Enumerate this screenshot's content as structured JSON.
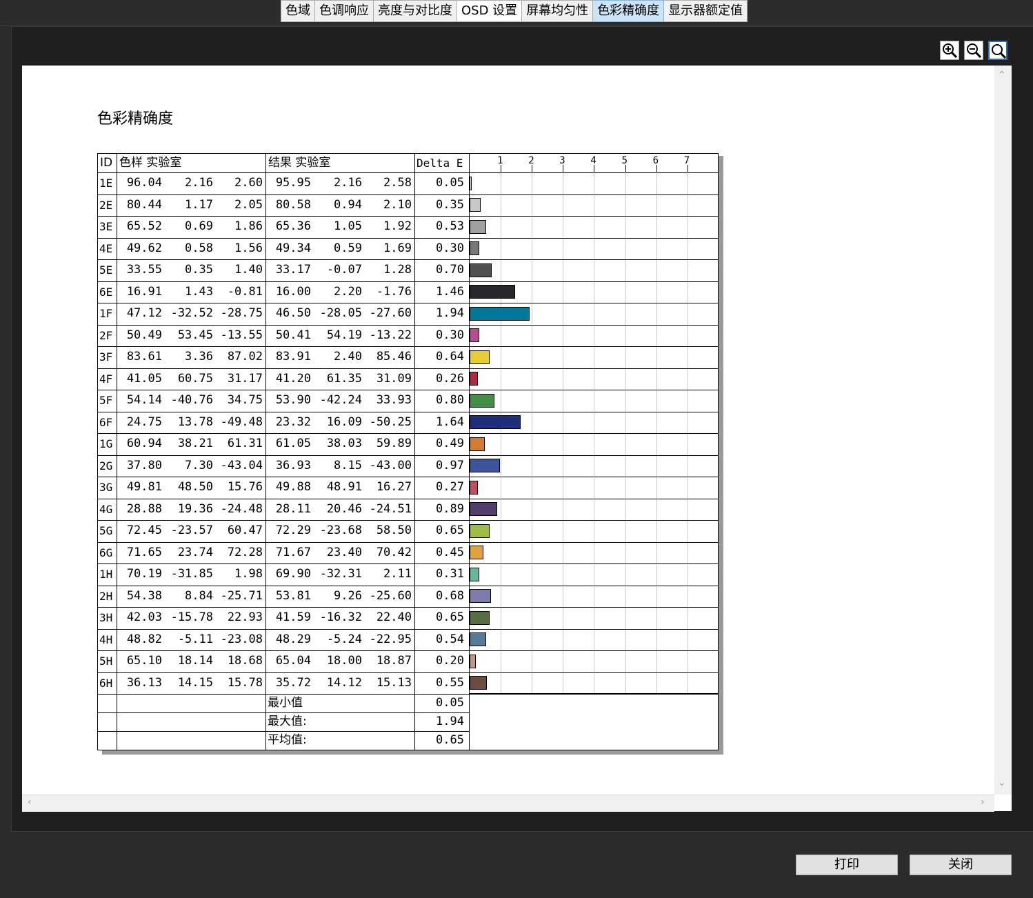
{
  "tabs": [
    "色域",
    "色调响应",
    "亮度与对比度",
    "OSD 设置",
    "屏幕均匀性",
    "色彩精确度",
    "显示器额定值"
  ],
  "active_tab": "色彩精确度",
  "zoom_icons": [
    "zoom-in-icon",
    "zoom-out-icon",
    "zoom-reset-icon"
  ],
  "report": {
    "title": "色彩精确度"
  },
  "table": {
    "headers": {
      "id": "ID",
      "sample": "色样 实验室",
      "result": "结果 实验室",
      "delta": "Delta E"
    },
    "axis_ticks": [
      "1",
      "2",
      "3",
      "4",
      "5",
      "6",
      "7"
    ],
    "rows": [
      {
        "id": "1E",
        "s": [
          "96.04",
          "2.16",
          "2.60"
        ],
        "r": [
          "95.95",
          "2.16",
          "2.58"
        ],
        "de": "0.05",
        "color": "#f2f2f2"
      },
      {
        "id": "2E",
        "s": [
          "80.44",
          "1.17",
          "2.05"
        ],
        "r": [
          "80.58",
          "0.94",
          "2.10"
        ],
        "de": "0.35",
        "color": "#c8c8c8"
      },
      {
        "id": "3E",
        "s": [
          "65.52",
          "0.69",
          "1.86"
        ],
        "r": [
          "65.36",
          "1.05",
          "1.92"
        ],
        "de": "0.53",
        "color": "#a0a0a0"
      },
      {
        "id": "4E",
        "s": [
          "49.62",
          "0.58",
          "1.56"
        ],
        "r": [
          "49.34",
          "0.59",
          "1.69"
        ],
        "de": "0.30",
        "color": "#787878"
      },
      {
        "id": "5E",
        "s": [
          "33.55",
          "0.35",
          "1.40"
        ],
        "r": [
          "33.17",
          "-0.07",
          "1.28"
        ],
        "de": "0.70",
        "color": "#505050"
      },
      {
        "id": "6E",
        "s": [
          "16.91",
          "1.43",
          "-0.81"
        ],
        "r": [
          "16.00",
          "2.20",
          "-1.76"
        ],
        "de": "1.46",
        "color": "#28282c"
      },
      {
        "id": "1F",
        "s": [
          "47.12",
          "-32.52",
          "-28.75"
        ],
        "r": [
          "46.50",
          "-28.05",
          "-27.60"
        ],
        "de": "1.94",
        "color": "#00789a"
      },
      {
        "id": "2F",
        "s": [
          "50.49",
          "53.45",
          "-13.55"
        ],
        "r": [
          "50.41",
          "54.19",
          "-13.22"
        ],
        "de": "0.30",
        "color": "#b94d94"
      },
      {
        "id": "3F",
        "s": [
          "83.61",
          "3.36",
          "87.02"
        ],
        "r": [
          "83.91",
          "2.40",
          "85.46"
        ],
        "de": "0.64",
        "color": "#e8cc36"
      },
      {
        "id": "4F",
        "s": [
          "41.05",
          "60.75",
          "31.17"
        ],
        "r": [
          "41.20",
          "61.35",
          "31.09"
        ],
        "de": "0.26",
        "color": "#b0283c"
      },
      {
        "id": "5F",
        "s": [
          "54.14",
          "-40.76",
          "34.75"
        ],
        "r": [
          "53.90",
          "-42.24",
          "33.93"
        ],
        "de": "0.80",
        "color": "#448f46"
      },
      {
        "id": "6F",
        "s": [
          "24.75",
          "13.78",
          "-49.48"
        ],
        "r": [
          "23.32",
          "16.09",
          "-50.25"
        ],
        "de": "1.64",
        "color": "#1e2e7a"
      },
      {
        "id": "1G",
        "s": [
          "60.94",
          "38.21",
          "61.31"
        ],
        "r": [
          "61.05",
          "38.03",
          "59.89"
        ],
        "de": "0.49",
        "color": "#d57b30"
      },
      {
        "id": "2G",
        "s": [
          "37.80",
          "7.30",
          "-43.04"
        ],
        "r": [
          "36.93",
          "8.15",
          "-43.00"
        ],
        "de": "0.97",
        "color": "#3e5498"
      },
      {
        "id": "3G",
        "s": [
          "49.81",
          "48.50",
          "15.76"
        ],
        "r": [
          "49.88",
          "48.91",
          "16.27"
        ],
        "de": "0.27",
        "color": "#c0505c"
      },
      {
        "id": "4G",
        "s": [
          "28.88",
          "19.36",
          "-24.48"
        ],
        "r": [
          "28.11",
          "20.46",
          "-24.51"
        ],
        "de": "0.89",
        "color": "#543e6c"
      },
      {
        "id": "5G",
        "s": [
          "72.45",
          "-23.57",
          "60.47"
        ],
        "r": [
          "72.29",
          "-23.68",
          "58.50"
        ],
        "de": "0.65",
        "color": "#9ebc48"
      },
      {
        "id": "6G",
        "s": [
          "71.65",
          "23.74",
          "72.28"
        ],
        "r": [
          "71.67",
          "23.40",
          "70.42"
        ],
        "de": "0.45",
        "color": "#e0a23c"
      },
      {
        "id": "1H",
        "s": [
          "70.19",
          "-31.85",
          "1.98"
        ],
        "r": [
          "69.90",
          "-32.31",
          "2.11"
        ],
        "de": "0.31",
        "color": "#62ba9c"
      },
      {
        "id": "2H",
        "s": [
          "54.38",
          "8.84",
          "-25.71"
        ],
        "r": [
          "53.81",
          "9.26",
          "-25.60"
        ],
        "de": "0.68",
        "color": "#7e7cac"
      },
      {
        "id": "3H",
        "s": [
          "42.03",
          "-15.78",
          "22.93"
        ],
        "r": [
          "41.59",
          "-16.32",
          "22.40"
        ],
        "de": "0.65",
        "color": "#566e42"
      },
      {
        "id": "4H",
        "s": [
          "48.82",
          "-5.11",
          "-23.08"
        ],
        "r": [
          "48.29",
          "-5.24",
          "-22.95"
        ],
        "de": "0.54",
        "color": "#557a9c"
      },
      {
        "id": "5H",
        "s": [
          "65.10",
          "18.14",
          "18.68"
        ],
        "r": [
          "65.04",
          "18.00",
          "18.87"
        ],
        "de": "0.20",
        "color": "#c29682"
      },
      {
        "id": "6H",
        "s": [
          "36.13",
          "14.15",
          "15.78"
        ],
        "r": [
          "35.72",
          "14.12",
          "15.13"
        ],
        "de": "0.55",
        "color": "#6a4c40"
      }
    ],
    "summary": [
      {
        "label": "最小值",
        "value": "0.05"
      },
      {
        "label": "最大值:",
        "value": "1.94"
      },
      {
        "label": "平均值:",
        "value": "0.65"
      }
    ]
  },
  "buttons": {
    "print": "打印",
    "close": "关闭"
  }
}
